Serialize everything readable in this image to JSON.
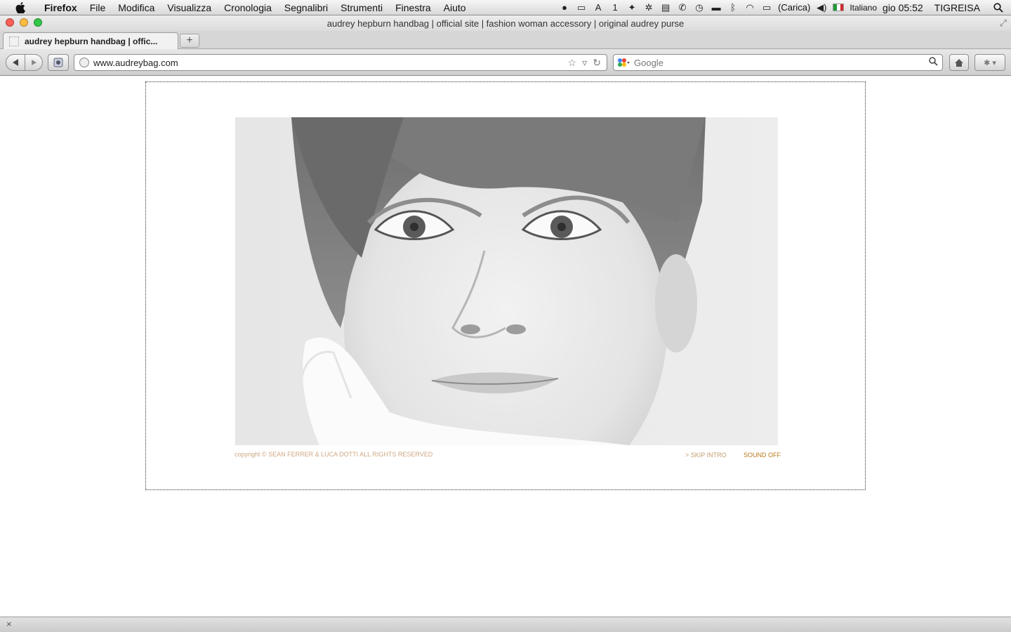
{
  "menubar": {
    "app_name": "Firefox",
    "items": [
      "File",
      "Modifica",
      "Visualizza",
      "Cronologia",
      "Segnalibri",
      "Strumenti",
      "Finestra",
      "Aiuto"
    ],
    "status": {
      "notification_count": "1",
      "battery_text": "(Carica)",
      "input_language": "Italiano",
      "clock": "gio 05:52",
      "user": "TIGREISA"
    }
  },
  "window": {
    "title": "audrey hepburn handbag | official site | fashion woman accessory | original audrey purse"
  },
  "tabs": [
    {
      "label": "audrey hepburn handbag | offic..."
    }
  ],
  "navbar": {
    "url": "www.audreybag.com",
    "search_placeholder": "Google"
  },
  "page": {
    "copyright": "copyright © SEAN FERRER & LUCA DOTTI ALL RIGHTS RESERVED",
    "skip_intro": "> SKIP INTRO",
    "sound_off": "SOUND OFF",
    "colors": {
      "copyright": "#cfa783",
      "skip_intro": "#c69b6c",
      "sound_off": "#b87919"
    }
  },
  "icons": {
    "apple": "apple-logo-icon",
    "back": "back-arrow-icon",
    "forward": "forward-arrow-icon",
    "bookmark_star": "star-icon",
    "reload": "reload-icon",
    "search": "magnifier-icon",
    "home": "home-icon"
  }
}
